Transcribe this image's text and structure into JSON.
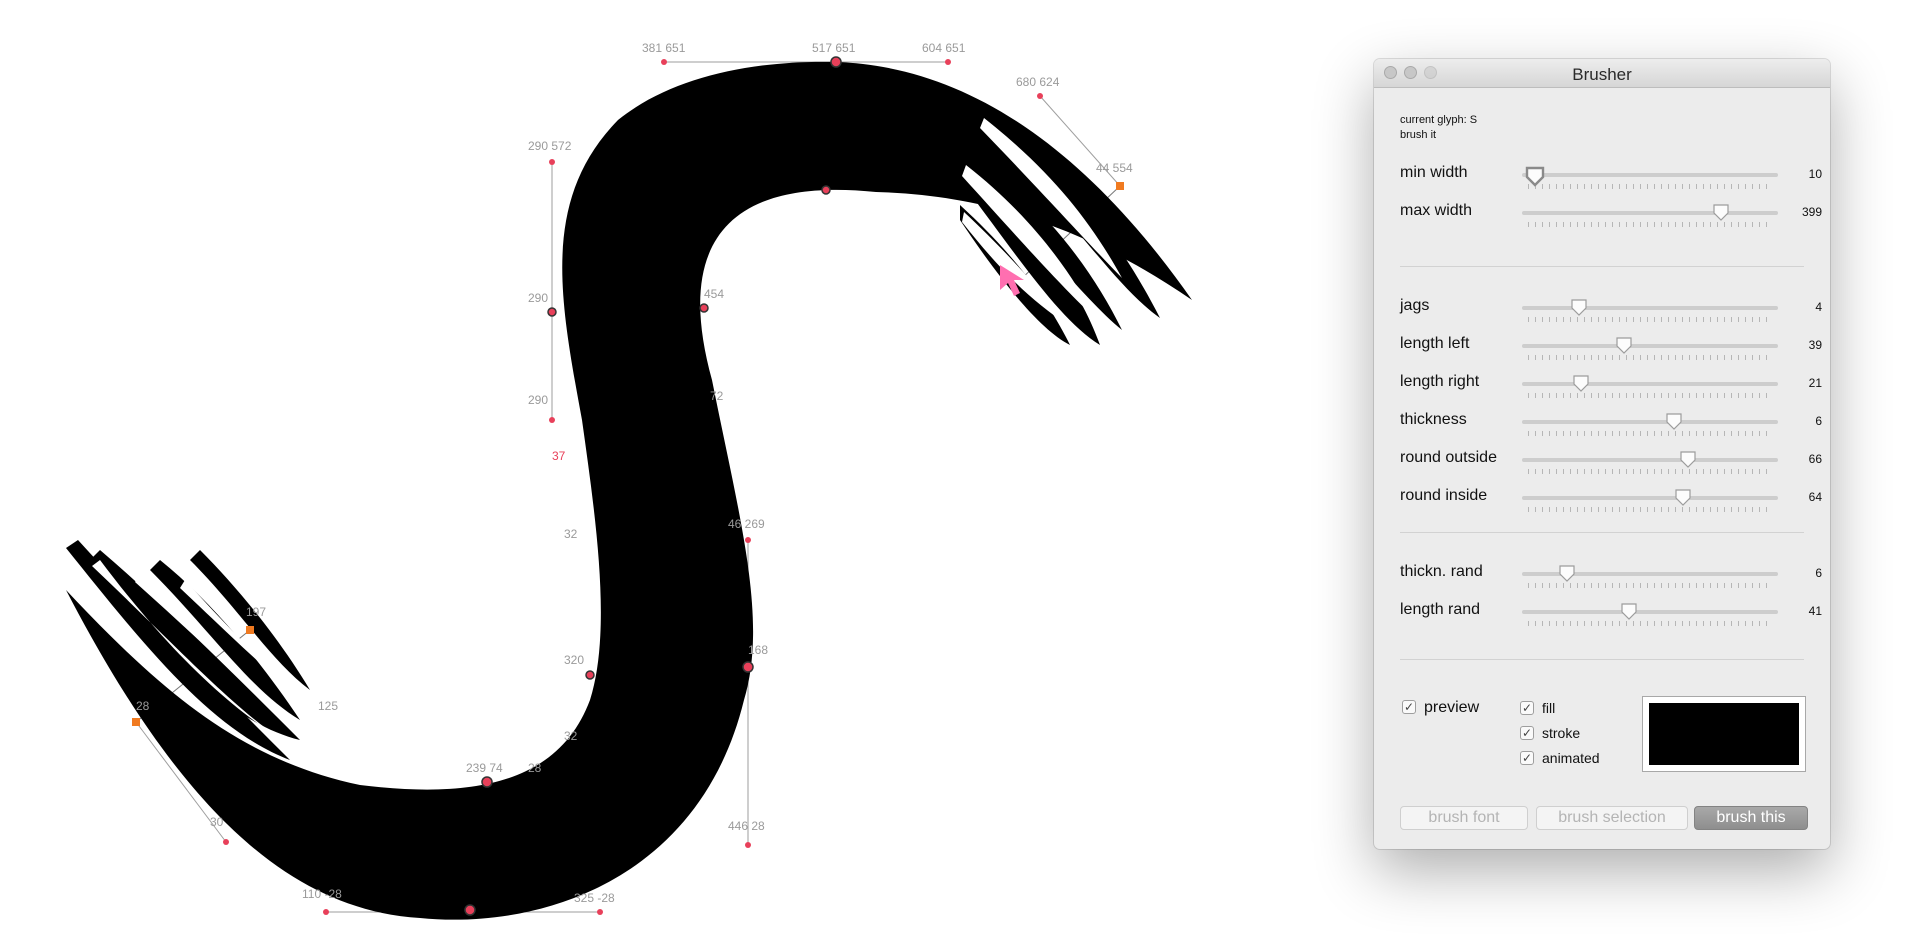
{
  "canvas": {
    "labels": {
      "l381_651": "381 651",
      "l517_651": "517 651",
      "l604_651": "604 651",
      "l680_624": "680 624",
      "l290_572": "290 572",
      "l44_554": "44 554",
      "l290_a": "290",
      "l454": "454",
      "l290_b": "290",
      "l72": "72",
      "l37": "37",
      "l32a": "32",
      "l46_269": "46 269",
      "l197": "197",
      "l320": "320",
      "l168": "168",
      "l125": "125",
      "l32b": "32",
      "l28": "28",
      "l239_74": "239 74",
      "l28x": "28",
      "l30": "30",
      "l446_28": "446 28",
      "l110_m28": "110 -28",
      "l325_m28": "325 -28"
    },
    "glyph_color": "#000000",
    "point_color": "#e8405a",
    "handle_color": "#f07a20"
  },
  "window": {
    "title": "Brusher",
    "current_glyph": "current glyph: S",
    "brush_it": "brush it",
    "groups": [
      [
        {
          "label": "min width",
          "value": 10,
          "min": 0,
          "max": 1000
        },
        {
          "label": "max width",
          "value": 399,
          "min": 0,
          "max": 500
        }
      ],
      [
        {
          "label": "jags",
          "value": 4,
          "min": 0,
          "max": 20
        },
        {
          "label": "length left",
          "value": 39,
          "min": 0,
          "max": 100
        },
        {
          "label": "length right",
          "value": 21,
          "min": 0,
          "max": 100
        },
        {
          "label": "thickness",
          "value": 6,
          "min": 0,
          "max": 10
        },
        {
          "label": "round outside",
          "value": 66,
          "min": 0,
          "max": 100
        },
        {
          "label": "round inside",
          "value": 64,
          "min": 0,
          "max": 100
        }
      ],
      [
        {
          "label": "thickn. rand",
          "value": 6,
          "min": 0,
          "max": 40
        },
        {
          "label": "length rand",
          "value": 41,
          "min": 0,
          "max": 100
        }
      ]
    ],
    "preview": {
      "label": "preview",
      "checked": true
    },
    "options": [
      {
        "label": "fill",
        "checked": true
      },
      {
        "label": "stroke",
        "checked": true
      },
      {
        "label": "animated",
        "checked": true
      }
    ],
    "color_well": "#000000",
    "buttons": {
      "brush_font": "brush font",
      "brush_selection": "brush selection",
      "brush_this": "brush this"
    }
  }
}
